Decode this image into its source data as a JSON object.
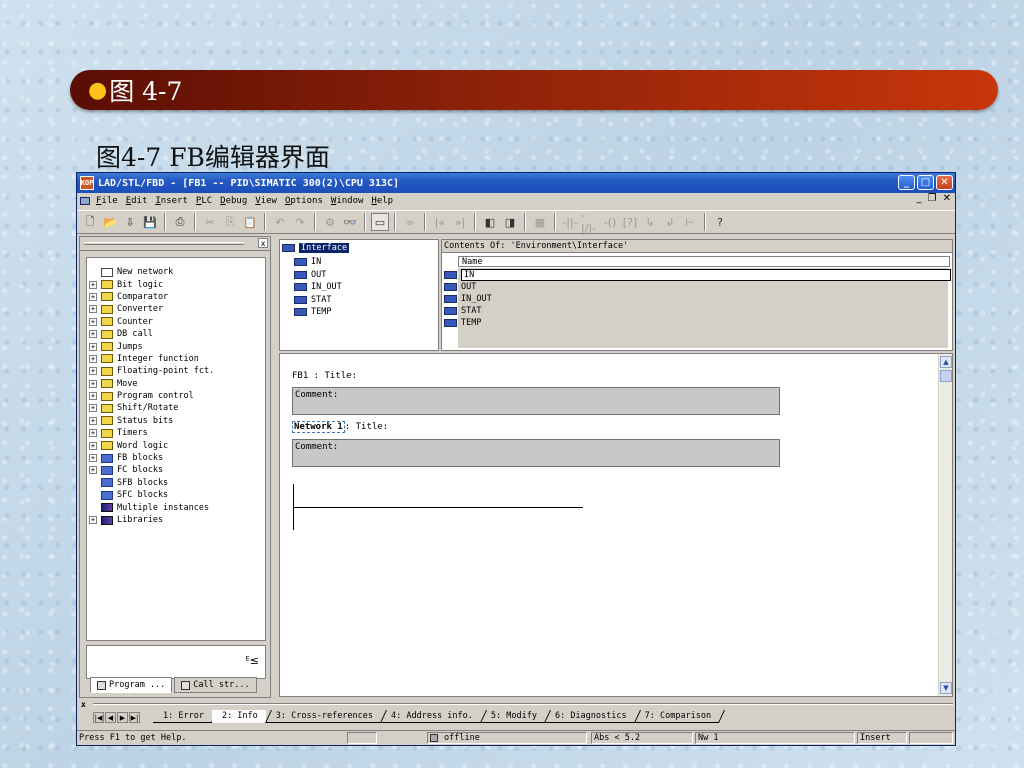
{
  "slide": {
    "bullet": "●",
    "title": "图 4-7",
    "caption": "图4-7 FB编辑器界面"
  },
  "window": {
    "title": "LAD/STL/FBD  - [FB1 -- PID\\SIMATIC 300(2)\\CPU 313C]",
    "app_icon": "KOP",
    "controls": {
      "minimize": "_",
      "maximize": "□",
      "close": "✕"
    },
    "mdi_controls": {
      "minimize": "_",
      "restore": "❐",
      "close": "✕"
    }
  },
  "menu": {
    "items": [
      {
        "accel": "F",
        "rest": "ile"
      },
      {
        "accel": "E",
        "rest": "dit"
      },
      {
        "accel": "I",
        "rest": "nsert"
      },
      {
        "accel": "P",
        "rest": "LC"
      },
      {
        "accel": "D",
        "rest": "ebug"
      },
      {
        "accel": "V",
        "rest": "iew"
      },
      {
        "accel": "O",
        "rest": "ptions"
      },
      {
        "accel": "W",
        "rest": "indow"
      },
      {
        "accel": "H",
        "rest": "elp"
      }
    ]
  },
  "toolbar": {
    "new": "🗋",
    "open": "📂",
    "download": "⇩",
    "save": "💾",
    "print": "⎙",
    "cut": "✂",
    "copy": "⎘",
    "paste": "📋",
    "undo": "↶",
    "redo": "↷",
    "compile": "⚙",
    "monitor": "👓",
    "overview": "▭",
    "ref": "∞",
    "prev": "|«",
    "next": "»|",
    "view1": "◧",
    "view2": "◨",
    "network": "▦",
    "contact_no": "-||-",
    "contact_nc": "-|/|-",
    "coil": "-()",
    "box": "[?]",
    "branch_open": "↳",
    "branch_close": "↲",
    "connect": "⊢",
    "help": "?"
  },
  "catalog": {
    "panel_close": "x",
    "items": [
      {
        "label": "New network",
        "icon": "new-network-icon",
        "expand": false
      },
      {
        "label": "Bit logic",
        "icon": "bit-logic-icon",
        "expand": true
      },
      {
        "label": "Comparator",
        "icon": "comparator-icon",
        "expand": true
      },
      {
        "label": "Converter",
        "icon": "converter-icon",
        "expand": true
      },
      {
        "label": "Counter",
        "icon": "counter-icon",
        "expand": true
      },
      {
        "label": "DB call",
        "icon": "db-call-icon",
        "expand": true
      },
      {
        "label": "Jumps",
        "icon": "jumps-icon",
        "expand": true
      },
      {
        "label": "Integer function",
        "icon": "integer-function-icon",
        "expand": true
      },
      {
        "label": "Floating-point fct.",
        "icon": "floating-point-icon",
        "expand": true
      },
      {
        "label": "Move",
        "icon": "move-icon",
        "expand": true
      },
      {
        "label": "Program control",
        "icon": "program-control-icon",
        "expand": true
      },
      {
        "label": "Shift/Rotate",
        "icon": "shift-rotate-icon",
        "expand": true
      },
      {
        "label": "Status bits",
        "icon": "status-bits-icon",
        "expand": true
      },
      {
        "label": "Timers",
        "icon": "timers-icon",
        "expand": true
      },
      {
        "label": "Word logic",
        "icon": "word-logic-icon",
        "expand": true
      },
      {
        "label": "FB blocks",
        "icon": "fb-blocks-icon",
        "expand": true
      },
      {
        "label": "FC blocks",
        "icon": "fc-blocks-icon",
        "expand": true
      },
      {
        "label": "SFB blocks",
        "icon": "sfb-blocks-icon",
        "expand": false
      },
      {
        "label": "SFC blocks",
        "icon": "sfc-blocks-icon",
        "expand": false
      },
      {
        "label": "Multiple instances",
        "icon": "multiple-instances-icon",
        "expand": false
      },
      {
        "label": "Libraries",
        "icon": "libraries-icon",
        "expand": true
      }
    ],
    "bottom_glyph": "ᴱ≤",
    "tabs": [
      {
        "label": "Program ..."
      },
      {
        "label": "Call str..."
      }
    ]
  },
  "interface_tree": {
    "root": "Interface",
    "children": [
      "IN",
      "OUT",
      "IN_OUT",
      "STAT",
      "TEMP"
    ]
  },
  "contents": {
    "header": "Contents Of: 'Environment\\Interface'",
    "column": "Name",
    "rows": [
      "IN",
      "OUT",
      "IN_OUT",
      "STAT",
      "TEMP"
    ]
  },
  "editor": {
    "block_title": "FB1 : Title:",
    "block_comment": "Comment:",
    "network_label": "Network 1",
    "network_title": ": Title:",
    "network_comment": "Comment:",
    "scroll_up": "▲",
    "scroll_down": "▼"
  },
  "details": {
    "close": "x",
    "nav": [
      "|◀",
      "◀",
      "▶",
      "▶|"
    ],
    "tabs": [
      "1: Error",
      "2: Info",
      "3: Cross-references",
      "4: Address info.",
      "5: Modify",
      "6: Diagnostics",
      "7: Comparison"
    ],
    "active_tab": 1
  },
  "status": {
    "help": "Press F1 to get Help.",
    "online": "offline",
    "version": "Abs < 5.2",
    "network": "Nw 1",
    "mode": "Insert"
  }
}
